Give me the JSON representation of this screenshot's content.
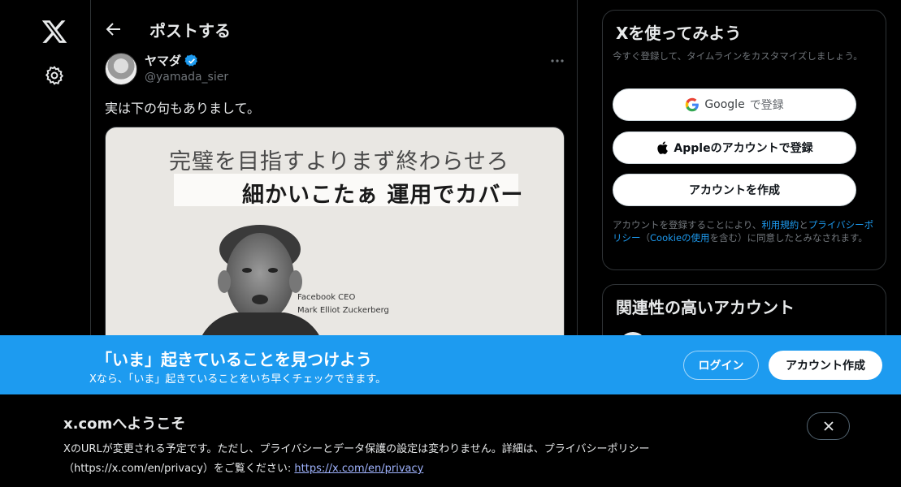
{
  "nav": {
    "logo_icon": "x-logo-icon",
    "settings_icon": "gear-icon"
  },
  "header": {
    "back_icon": "arrow-left-icon",
    "title": "ポストする"
  },
  "post": {
    "author_name": "ヤマダ",
    "author_handle": "@yamada_sier",
    "verified_icon": "verified-badge-icon",
    "more_icon": "more-icon",
    "text": "実は下の句もありまして。",
    "image": {
      "line1": "完璧を目指すよりまず終わらせろ",
      "line2": "細かいこたぁ 運用でカバー",
      "caption1": "Facebook  CEO",
      "caption2": "Mark Elliot Zuckerberg"
    }
  },
  "signup": {
    "title": "Xを使ってみよう",
    "subtitle": "今すぐ登録して、タイムラインをカスタマイズしましょう。",
    "google_label": "Google",
    "google_suffix": "で登録",
    "apple_label": "Appleのアカウントで登録",
    "create_label": "アカウントを作成",
    "terms_pre": "アカウントを登録することにより、",
    "terms_link1": "利用規約",
    "terms_mid1": "と",
    "terms_link2": "プライバシーポリシー",
    "terms_mid2": "（",
    "terms_link3": "Cookieの使用",
    "terms_post": "を含む）に同意したとみなされます。"
  },
  "related": {
    "title": "関連性の高いアカウント"
  },
  "banner": {
    "title": "「いま」起きていることを見つけよう",
    "subtitle": "Xなら、「いま」起きていることをいち早くチェックできます。",
    "login_label": "ログイン",
    "signup_label": "アカウント作成"
  },
  "notice": {
    "title": "x.comへようこそ",
    "body": "XのURLが変更される予定です。ただし、プライバシーとデータ保護の設定は変わりません。詳細は、プライバシーポリシー（https://x.com/en/privacy）をご覧ください: ",
    "link": "https://x.com/en/privacy",
    "close_icon": "close-icon"
  },
  "colors": {
    "accent": "#1d9bf0",
    "background": "#000000",
    "border": "#2f3336",
    "muted_text": "#71767b"
  }
}
